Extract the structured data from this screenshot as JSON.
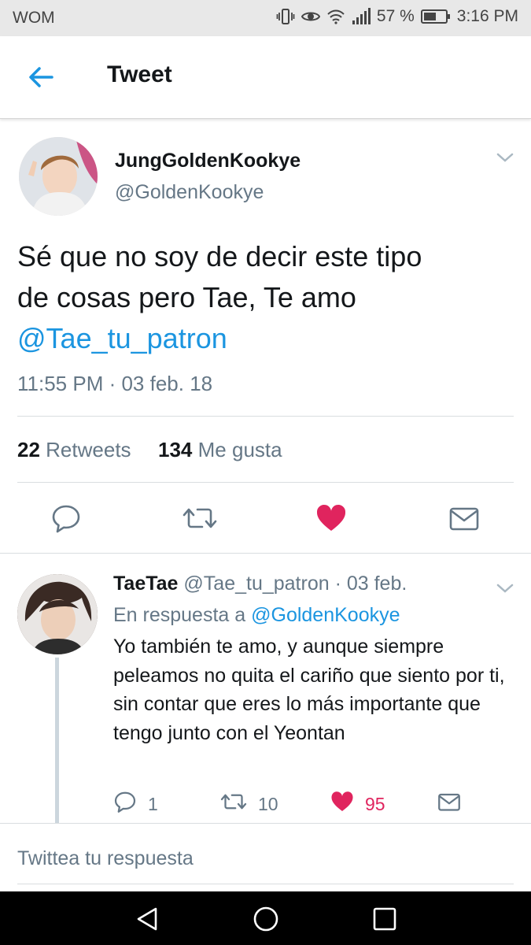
{
  "status_bar": {
    "carrier": "WOM",
    "battery_percent": "57 %",
    "time": "3:16 PM",
    "icons": [
      "vibrate-icon",
      "eye-icon",
      "wifi-icon",
      "signal-icon",
      "battery-icon"
    ]
  },
  "app_bar": {
    "back_icon": "arrow-left-icon",
    "title": "Tweet"
  },
  "tweet": {
    "display_name": "JungGoldenKookye",
    "handle": "@GoldenKookye",
    "text_line1": "Sé que no soy de decir este tipo",
    "text_line2": "de cosas pero Tae, Te amo",
    "mention": "@Tae_tu_patron",
    "timestamp": "11:55 PM · 03 feb. 18",
    "retweets_count": "22",
    "retweets_label": "Retweets",
    "likes_count": "134",
    "likes_label": "Me gusta",
    "liked": true
  },
  "reply": {
    "display_name": "TaeTae",
    "handle_and_date": "@Tae_tu_patron · 03 feb.",
    "in_reply_prefix": "En respuesta a",
    "in_reply_handle": "@GoldenKookye",
    "text": "Yo también te amo, y aunque siempre peleamos no quita el cariño que siento por ti, sin contar que eres lo más importante que tengo junto con el Yeontan",
    "reply_count": "1",
    "retweet_count": "10",
    "like_count": "95",
    "liked": true
  },
  "compose": {
    "placeholder": "Twittea tu respuesta"
  },
  "colors": {
    "link_blue": "#1b95e0",
    "like_pink": "#e0245e",
    "secondary_gray": "#657786",
    "primary_text": "#14171a"
  }
}
